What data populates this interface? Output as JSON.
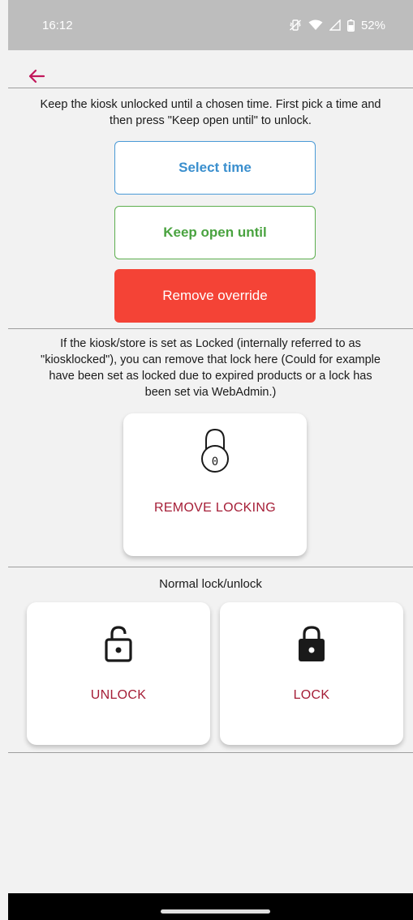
{
  "status_bar": {
    "time": "16:12",
    "battery_percent": "52%",
    "icons": [
      "vibrate-off-icon",
      "wifi-icon",
      "signal-icon",
      "battery-icon"
    ]
  },
  "toolbar": {
    "back_icon": "arrow-left-icon",
    "accent_color": "#c2185b"
  },
  "override_section": {
    "description_line1": "Keep the kiosk unlocked until a chosen time. First pick a time and",
    "description_line2": "then press \"Keep open until\" to unlock.",
    "select_time_label": "Select time",
    "keep_open_label": "Keep open until",
    "remove_override_label": "Remove override"
  },
  "kiosklock_section": {
    "description_line1": "If the kiosk/store is set as Locked (internally referred to as",
    "description_line2": "\"kiosklocked\"), you can remove that lock here (Could for example",
    "description_line3": "have been set as locked due to expired products or a lock has",
    "description_line4": "been set via WebAdmin.)",
    "padlock_digit": "0",
    "remove_locking_label": "REMOVE LOCKING"
  },
  "normal_section": {
    "title": "Normal lock/unlock",
    "unlock_label": "UNLOCK",
    "lock_label": "LOCK"
  },
  "colors": {
    "select_time": "#3a8fce",
    "keep_open": "#4aa340",
    "remove_override_bg": "#f44336",
    "card_label": "#a51d36"
  }
}
